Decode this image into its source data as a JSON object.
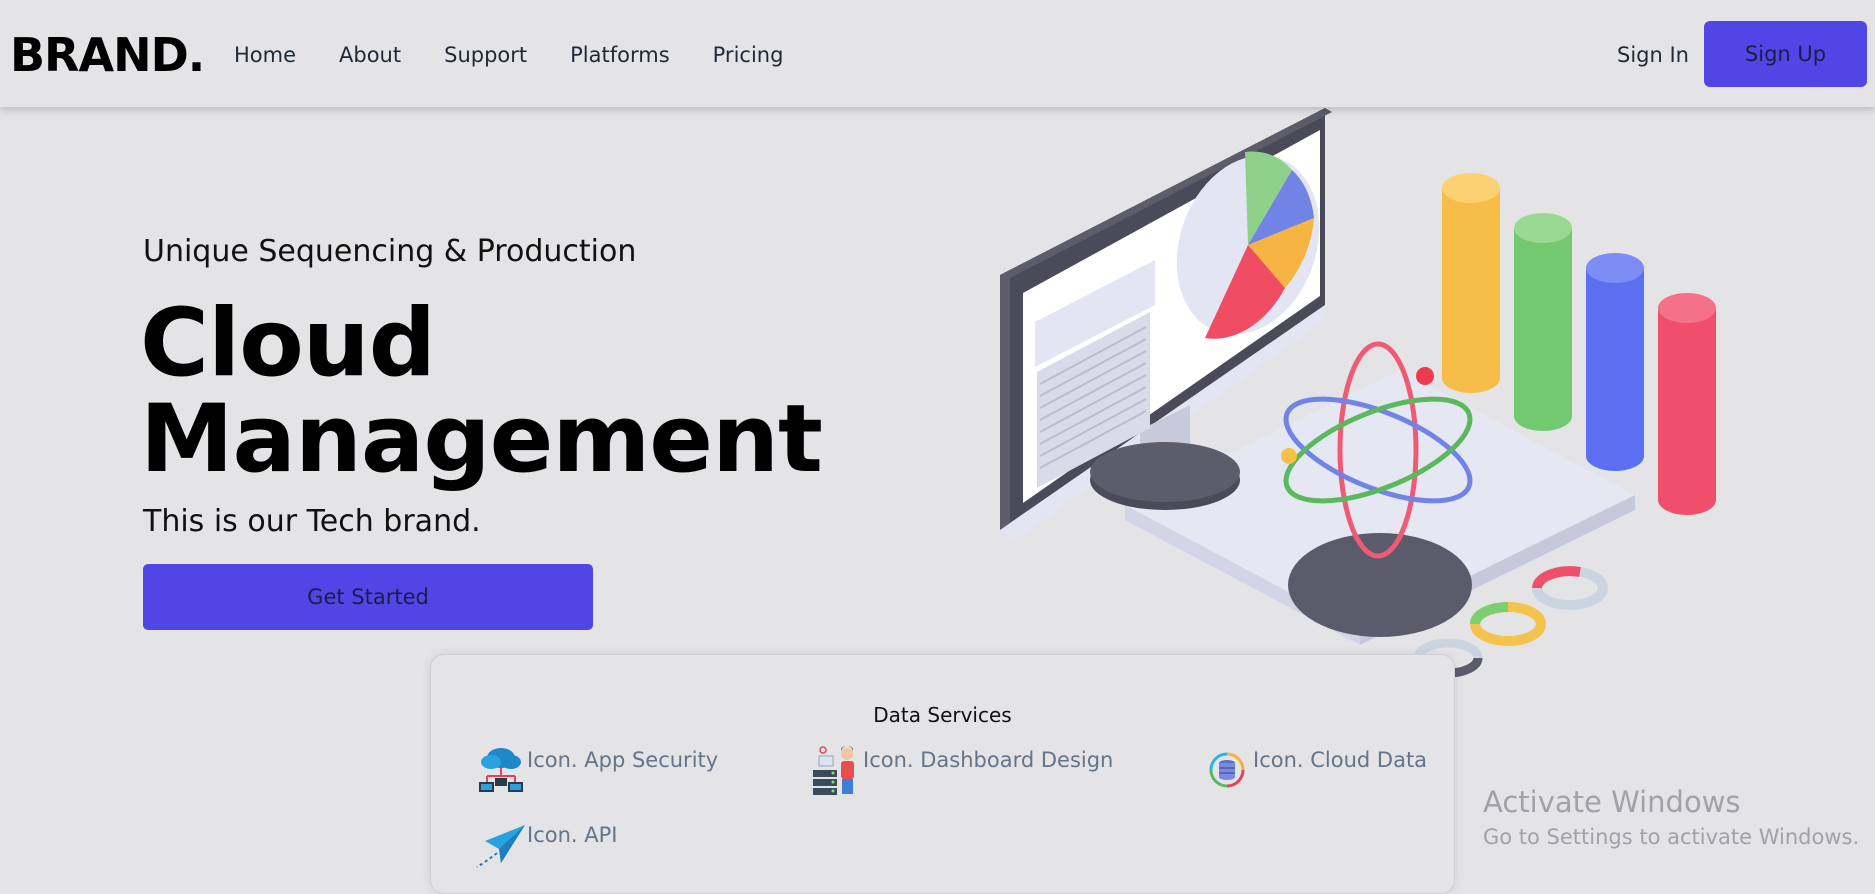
{
  "nav": {
    "brand": "BRAND.",
    "links": [
      "Home",
      "About",
      "Support",
      "Platforms",
      "Pricing"
    ],
    "sign_in": "Sign In",
    "sign_up": "Sign Up"
  },
  "hero": {
    "subtitle": "Unique Sequencing & Production",
    "title_line1": "Cloud",
    "title_line2": "Management",
    "tagline": "This is our Tech brand.",
    "cta": "Get Started"
  },
  "services": {
    "title": "Data Services",
    "items": [
      {
        "label": "Icon. App Security",
        "icon": "cloud-network-icon"
      },
      {
        "label": "Icon. Dashboard Design",
        "icon": "developer-server-icon"
      },
      {
        "label": "Icon. Cloud Data",
        "icon": "database-sync-icon"
      },
      {
        "label": "Icon. API",
        "icon": "paper-plane-icon"
      }
    ]
  },
  "watermark": {
    "title": "Activate Windows",
    "subtitle": "Go to Settings to activate Windows."
  },
  "colors": {
    "accent": "#4f46e5",
    "background": "#e4e4e7",
    "muted_text": "#64748b"
  }
}
